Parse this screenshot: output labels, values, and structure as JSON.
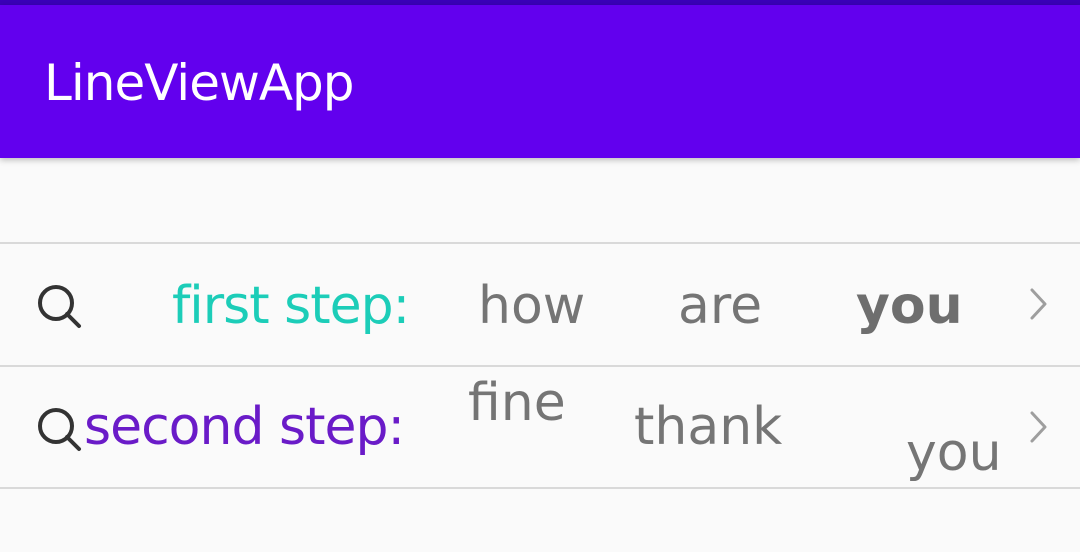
{
  "app_bar": {
    "title": "LineViewApp",
    "color": "#6200ee"
  },
  "rows": [
    {
      "icon": "search-icon",
      "label": "first step:",
      "label_color": "#1ccdb8",
      "words": [
        "how",
        "are",
        "you"
      ],
      "emphasized_word": "you",
      "trailing_icon": "chevron-right-icon"
    },
    {
      "icon": "search-icon",
      "label": "second step:",
      "label_color": "#6a1bc8",
      "words": [
        "fine",
        "thank",
        "you"
      ],
      "trailing_icon": "chevron-right-icon"
    }
  ]
}
